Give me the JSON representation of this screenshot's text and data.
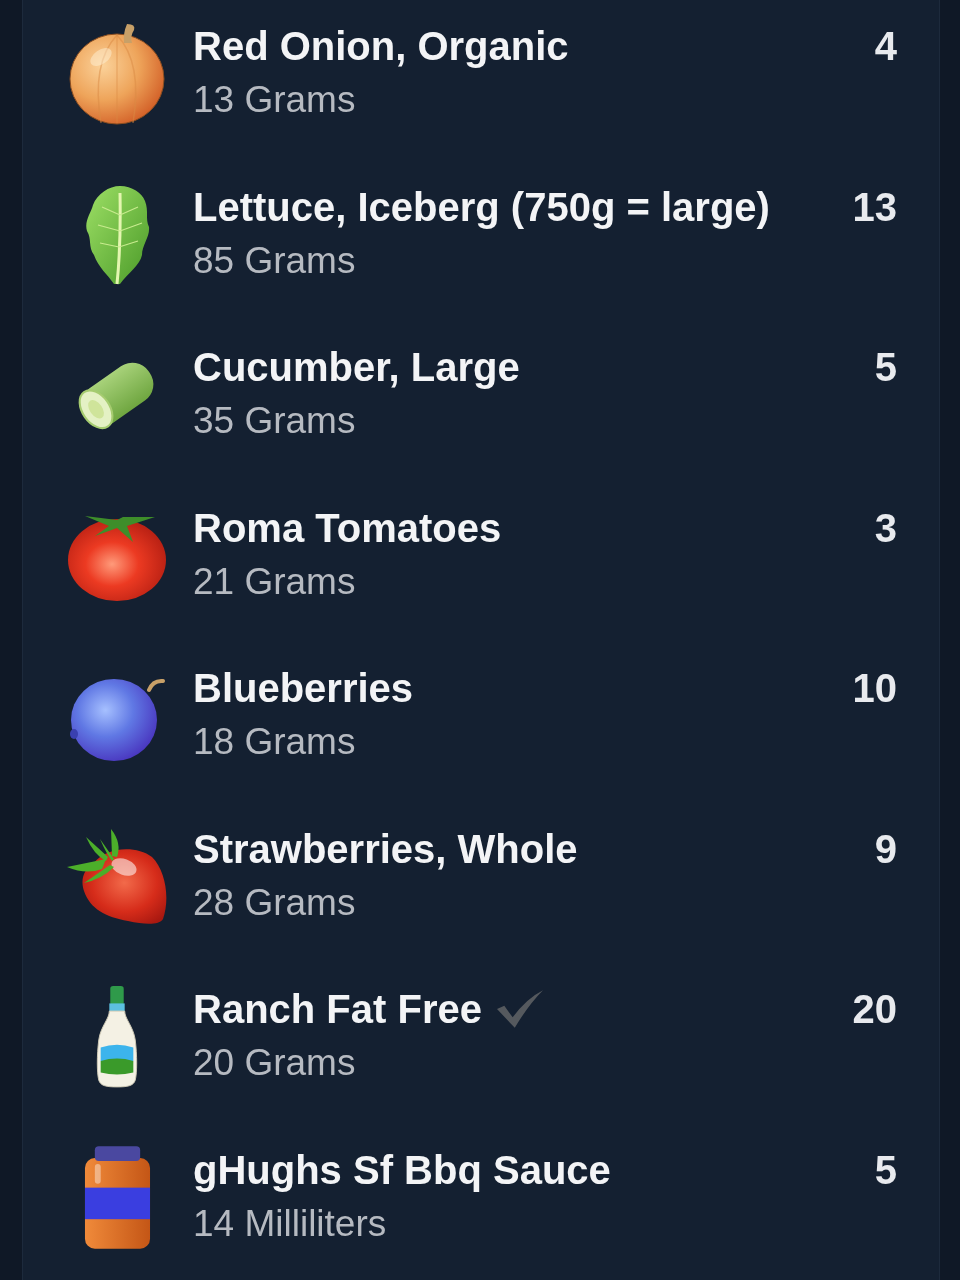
{
  "items": [
    {
      "name": "Red Onion, Organic",
      "amount": "13 Grams",
      "value": "4",
      "verified": false
    },
    {
      "name": "Lettuce, Iceberg (750g = large)",
      "amount": "85 Grams",
      "value": "13",
      "verified": false
    },
    {
      "name": "Cucumber, Large",
      "amount": "35 Grams",
      "value": "5",
      "verified": false
    },
    {
      "name": "Roma Tomatoes",
      "amount": "21 Grams",
      "value": "3",
      "verified": false
    },
    {
      "name": "Blueberries",
      "amount": "18 Grams",
      "value": "10",
      "verified": false
    },
    {
      "name": "Strawberries, Whole",
      "amount": "28 Grams",
      "value": "9",
      "verified": false
    },
    {
      "name": "Ranch Fat Free",
      "amount": "20 Grams",
      "value": "20",
      "verified": true
    },
    {
      "name": "gHughs Sf Bbq Sauce",
      "amount": "14 Milliliters",
      "value": "5",
      "verified": false
    }
  ]
}
